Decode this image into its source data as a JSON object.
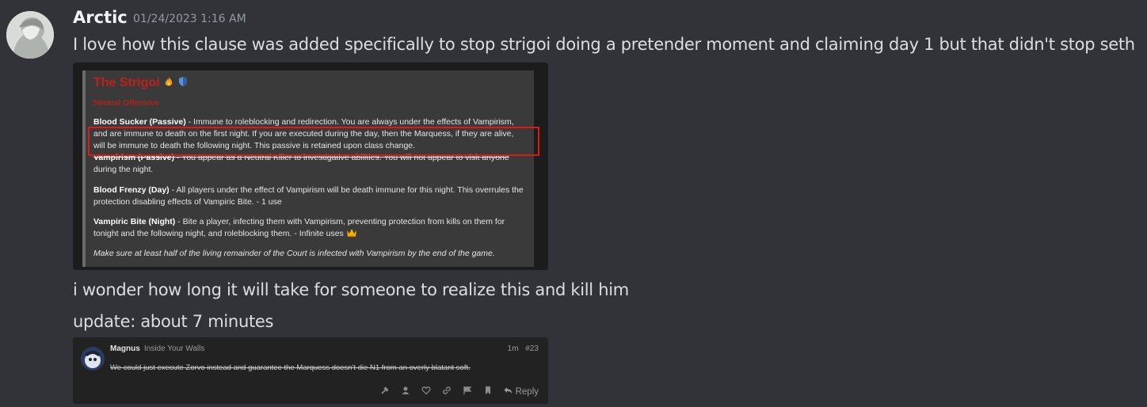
{
  "message": {
    "author": "Arctic",
    "timestamp": "01/24/2023 1:16 AM",
    "line1": "I love how this clause was added specifically to stop strigoi doing a pretender moment and claiming day 1 but that didn't stop seth",
    "line2": "i wonder how long it will take for someone to realize this and kill him",
    "line3": "update: about 7 minutes"
  },
  "embed_strigoi": {
    "title": "The Strigoi",
    "subtitle": "Neutral Offensive",
    "blood_sucker_name": "Blood Sucker (Passive)",
    "blood_sucker_1": " - Immune to roleblocking and redirection. You are always under the effects of Vampirism,",
    "blood_sucker_2": "and are immune to death on the first night. If you are executed during the day, then the Marquess, if they are alive,",
    "blood_sucker_3": "will be immune to death the following night. This passive is retained upon class change.",
    "vampirism_name": "Vampirism (Passive)",
    "vampirism_1": " - You appear as a Neutral Killer to investigative abilities. You will not appear to visit anyone",
    "vampirism_2": "during the night.",
    "frenzy_name": "Blood Frenzy (Day)",
    "frenzy_1": " - All players under the effect of Vampirism will be death immune for this night. This overrules the",
    "frenzy_2": "protection disabling effects of Vampiric Bite. - 1 use",
    "bite_name": "Vampiric Bite (Night)",
    "bite_1": " - Bite a player, infecting them with Vampirism, preventing protection from kills on them for",
    "bite_2": "tonight and the following night, and roleblocking them. - Infinite uses",
    "goal": "Make sure at least half of the living remainder of the Court is infected with Vampirism by the end of the game.",
    "icons": [
      "fire-icon",
      "shield-icon",
      "crown-icon"
    ]
  },
  "embed_forum": {
    "name": "Magnus",
    "user_title": "Inside Your Walls",
    "meta": "1m #23",
    "post": "We could just execute Zorvo instead and guarantee the Marquess doesn't die N1 from an overly blatant soft.",
    "reply_label": "Reply",
    "action_icons": [
      "hammer-icon",
      "user-icon",
      "heart-icon",
      "link-icon",
      "flag-icon",
      "bookmark-icon",
      "reply-icon"
    ]
  },
  "colors": {
    "background": "#313338",
    "strigoi_red": "#c0201a",
    "highlight_box": "#e01818"
  }
}
